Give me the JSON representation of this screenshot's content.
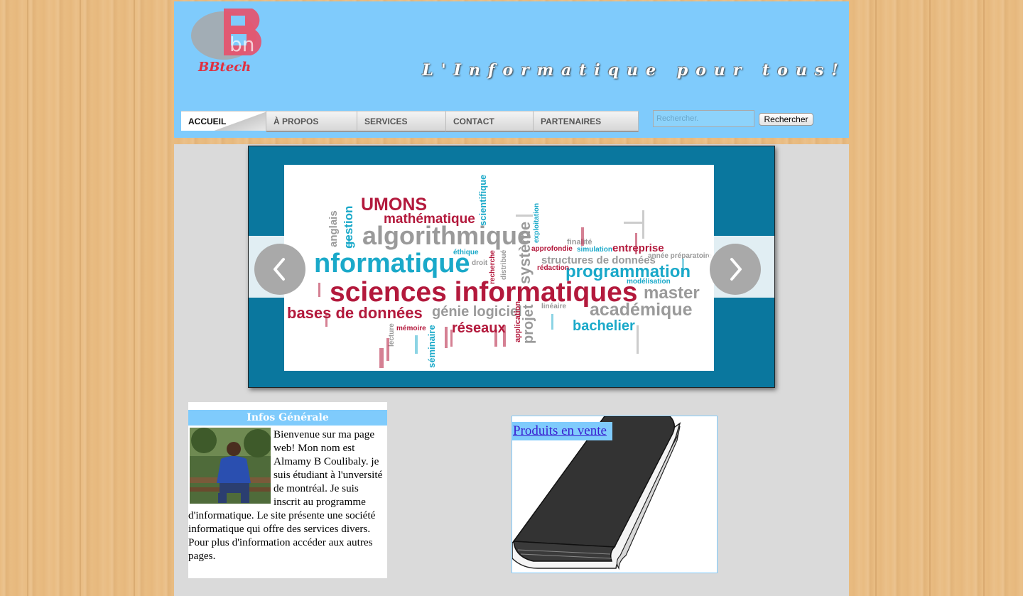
{
  "header": {
    "logo_text": "BBtech",
    "slogan": "L'Informatique pour tous!"
  },
  "nav": {
    "items": [
      {
        "label": "ACCUEIL",
        "active": true
      },
      {
        "label": "À PROPOS",
        "active": false
      },
      {
        "label": "SERVICES",
        "active": false
      },
      {
        "label": "CONTACT",
        "active": false
      },
      {
        "label": "PARTENAIRES",
        "active": false
      }
    ]
  },
  "search": {
    "placeholder": "Rechercher.",
    "button_label": "Rechercher"
  },
  "slideshow": {
    "prev_icon": "chevron-left-icon",
    "next_icon": "chevron-right-icon",
    "words": {
      "umons": "UMONS",
      "mathematique": "mathématique",
      "scientifique": "scientifique",
      "algorithmique": "algorithmique",
      "informatique": "nformatique",
      "sciences_informatiques": "sciences informatiques",
      "bases_de_donnees": "bases de données",
      "genie_logiciel": "génie logiciel",
      "reseaux": "réseaux",
      "projet": "projet",
      "systeme": "système",
      "programmation": "programmation",
      "master": "master",
      "academique": "académique",
      "bachelier": "bachelier",
      "entreprise": "entreprise",
      "structures": "structures de données",
      "gestion": "gestion",
      "anglais": "anglais",
      "seminaire": "séminaire",
      "application": "application",
      "approfondie": "approfondie",
      "simulation": "simulation",
      "exploitation": "exploitation",
      "redaction": "rédaction",
      "modelisation": "modélisation",
      "annee": "année préparatoire",
      "finalite": "finalité",
      "ethique": "éthique",
      "recherche": "recherche",
      "lecture": "lecture",
      "memoire": "mémoire",
      "lineaire": "linéaire",
      "droit": "droit",
      "distribue": "distribué"
    }
  },
  "infos": {
    "title": "Infos Générale",
    "text": "Bienvenue sur ma page web! Mon nom est Almamy B Coulibaly. je suis étudiant à l'unversité de montréal. Je suis inscrit au programme d'informatique. Le site présente une société informatique qui offre des services divers. Pour plus d'information accéder aux autres pages."
  },
  "products": {
    "link_label": "Produits en vente"
  },
  "colors": {
    "header_blue": "#7fcbfc",
    "slideshow_blue": "#0a779e",
    "word_red": "#b3193c",
    "word_cyan": "#1aa9c9",
    "word_gray": "#9a9a9a",
    "link": "#3a1fd0"
  }
}
